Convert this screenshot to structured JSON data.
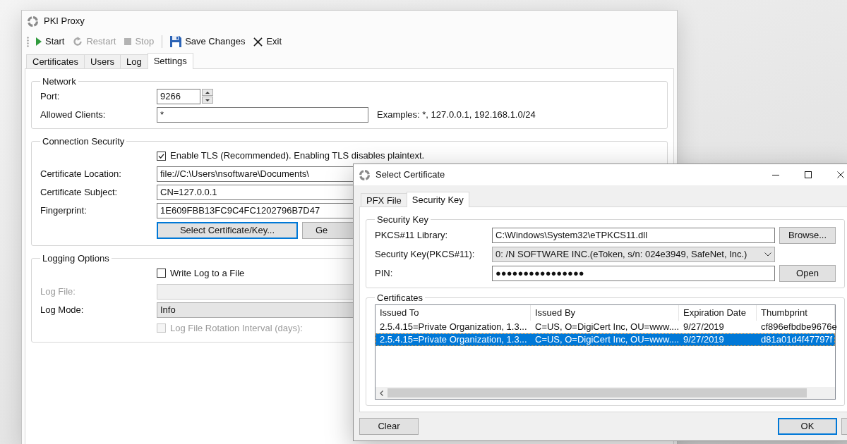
{
  "main_window": {
    "title": "PKI Proxy",
    "toolbar": [
      {
        "kind": "start",
        "label": "Start",
        "disabled": false
      },
      {
        "kind": "restart",
        "label": "Restart",
        "disabled": true
      },
      {
        "kind": "stop",
        "label": "Stop",
        "disabled": true
      },
      {
        "kind": "separator"
      },
      {
        "kind": "save",
        "label": "Save Changes",
        "disabled": false
      },
      {
        "kind": "exit",
        "label": "Exit",
        "disabled": false
      }
    ],
    "tabs": [
      {
        "label": "Certificates",
        "selected": false
      },
      {
        "label": "Users",
        "selected": false
      },
      {
        "label": "Log",
        "selected": false
      },
      {
        "label": "Settings",
        "selected": true
      }
    ],
    "network": {
      "title": "Network",
      "port": {
        "label": "Port:",
        "value": "9266"
      },
      "allowed_clients": {
        "label": "Allowed Clients:",
        "value": "*",
        "note": "Examples: *, 127.0.0.1, 192.168.1.0/24"
      }
    },
    "connection_security": {
      "title": "Connection Security",
      "enable_tls": {
        "label": "Enable TLS (Recommended). Enabling TLS disables plaintext.",
        "checked": true
      },
      "fields": [
        {
          "label": "Certificate Location:",
          "value": "file://C:\\Users\\nsoftware\\Documents\\"
        },
        {
          "label": "Certificate Subject:",
          "value": "CN=127.0.0.1"
        },
        {
          "label": "Fingerprint:",
          "value": "1E609FBB13FC9C4FC1202796B7D47"
        }
      ],
      "buttons": [
        {
          "label": "Select Certificate/Key...",
          "focused": true
        },
        {
          "label": "Ge",
          "focused": false
        }
      ]
    },
    "logging_options": {
      "title": "Logging Options",
      "write_log": {
        "label": "Write Log to a File",
        "checked": false
      },
      "log_file": {
        "label": "Log File:",
        "disabled": true
      },
      "log_mode": {
        "label": "Log Mode:",
        "value": "Info"
      },
      "rotation": {
        "label": "Log File Rotation Interval (days):",
        "checked": false,
        "disabled": true
      }
    }
  },
  "dialog": {
    "title": "Select Certificate",
    "tabs": [
      {
        "label": "PFX File",
        "selected": false
      },
      {
        "label": "Security Key",
        "selected": true
      }
    ],
    "security_key": {
      "title": "Security Key",
      "library": {
        "label": "PKCS#11 Library:",
        "value": "C:\\Windows\\System32\\eTPKCS11.dll",
        "button": "Browse..."
      },
      "key": {
        "label": "Security Key(PKCS#11):",
        "value": "0: /N SOFTWARE INC.(eToken, s/n: 024e3949, SafeNet, Inc.)"
      },
      "pin": {
        "label": "PIN:",
        "value": "●●●●●●●●●●●●●●●●",
        "button": "Open"
      }
    },
    "certificates": {
      "title": "Certificates",
      "columns": [
        "Issued To",
        "Issued By",
        "Expiration Date",
        "Thumbprint"
      ],
      "rows": [
        {
          "cells": [
            "2.5.4.15=Private Organization, 1.3...",
            "C=US, O=DigiCert Inc, OU=www....",
            "9/27/2019",
            "cf896efbdbe9676e"
          ],
          "selected": false
        },
        {
          "cells": [
            "2.5.4.15=Private Organization, 1.3...",
            "C=US, O=DigiCert Inc, OU=www....",
            "9/27/2019",
            "d81a01d4f47797f"
          ],
          "selected": true
        }
      ]
    },
    "footer": {
      "left": [
        {
          "label": "Clear",
          "focused": false
        }
      ],
      "right": [
        {
          "label": "OK",
          "focused": true
        },
        {
          "focused": false
        }
      ]
    }
  }
}
